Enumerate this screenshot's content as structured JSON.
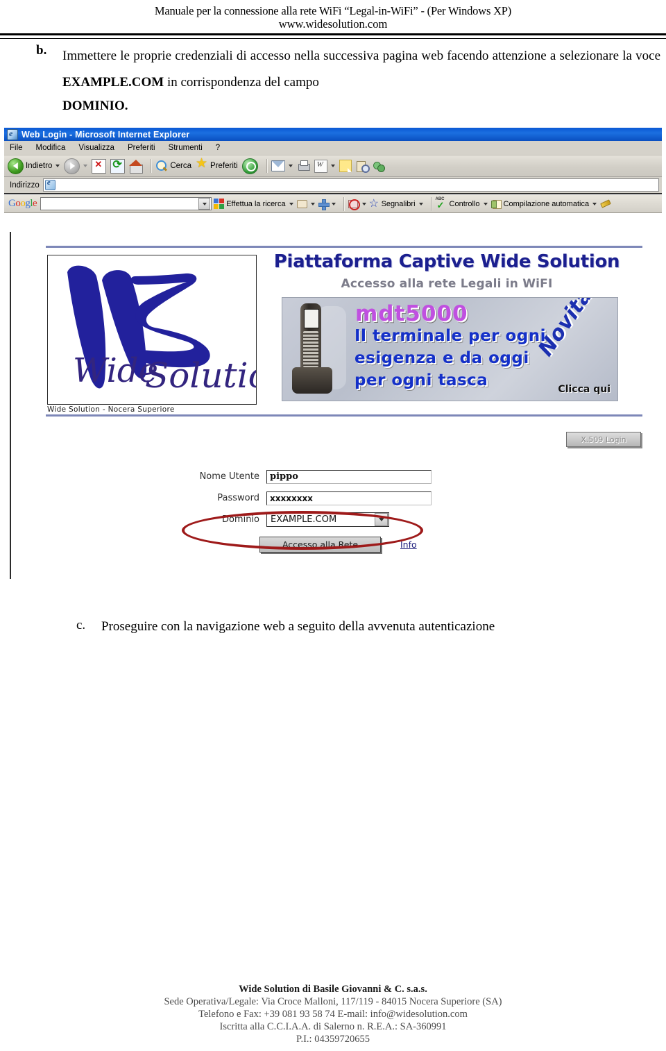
{
  "document": {
    "header": {
      "line1": "Manuale per la connessione alla rete WiFi “Legal-in-WiFi” - (Per Windows XP)",
      "line2": "www.widesolution.com"
    },
    "paragraph_b": {
      "marker": "b.",
      "text_part1": "Immettere le proprie credenziali di accesso nella successiva pagina web facendo attenzione a selezionare la voce ",
      "bold_term": "EXAMPLE.COM",
      "text_part2": " in corrispondenza del campo",
      "last_line": "DOMINIO."
    },
    "paragraph_c": {
      "marker": "c.",
      "text": "Proseguire con la navigazione web a seguito della avvenuta autenticazione"
    },
    "footer": {
      "company": "Wide Solution di Basile Giovanni & C. s.a.s.",
      "address": "Sede Operativa/Legale: Via Croce Malloni, 117/119 - 84015 Nocera Superiore (SA)",
      "contacts": "Telefono e Fax: +39 081 93 58 74 E-mail: info@widesolution.com",
      "registration": "Iscritta alla C.C.I.A.A. di Salerno n. R.E.A.: SA-360991",
      "vat": "P.I.: 04359720655"
    }
  },
  "screenshot": {
    "browser": {
      "title": "Web Login - Microsoft Internet Explorer",
      "menu_items": [
        "File",
        "Modifica",
        "Visualizza",
        "Preferiti",
        "Strumenti",
        "?"
      ],
      "toolbar": {
        "back_label": "Indietro",
        "search_label": "Cerca",
        "favorites_label": "Preferiti"
      },
      "address_bar": {
        "label": "Indirizzo",
        "value": ""
      },
      "google_bar": {
        "logo_letters": [
          "G",
          "o",
          "o",
          "g",
          "l",
          "e"
        ],
        "search_value": "",
        "search_button_label": "Effettua la ricerca",
        "bookmarks_label": "Segnalibri",
        "check_label": "Controllo",
        "autofill_label": "Compilazione automatica"
      }
    },
    "page": {
      "logo_caption": "Wide Solution - Nocera Superiore",
      "platform_title": "Piattaforma Captive Wide Solution",
      "platform_subtitle": "Accesso alla rete Legali in WiFI",
      "banner": {
        "product": "mdt5000",
        "line1": "Il terminale per ogni",
        "line2": "esigenza e da oggi",
        "line3": "per ogni tasca",
        "badge": "Novità",
        "cta": "Clicca qui"
      },
      "x509_button": "X.509 Login",
      "form": {
        "username_label": "Nome Utente",
        "username_value": "pippo",
        "password_label": "Password",
        "password_value": "xxxxxxxx",
        "domain_label": "Dominio",
        "domain_value": "EXAMPLE.COM",
        "submit_label": "Accesso alla Rete",
        "info_link": "Info"
      }
    }
  },
  "colors": {
    "title_blue": "#1b1f8f",
    "banner_purple": "#c050e0",
    "banner_blue": "#1430c8",
    "annotation_red": "#9e1a1a",
    "titlebar_blue": "#0b59d4"
  }
}
